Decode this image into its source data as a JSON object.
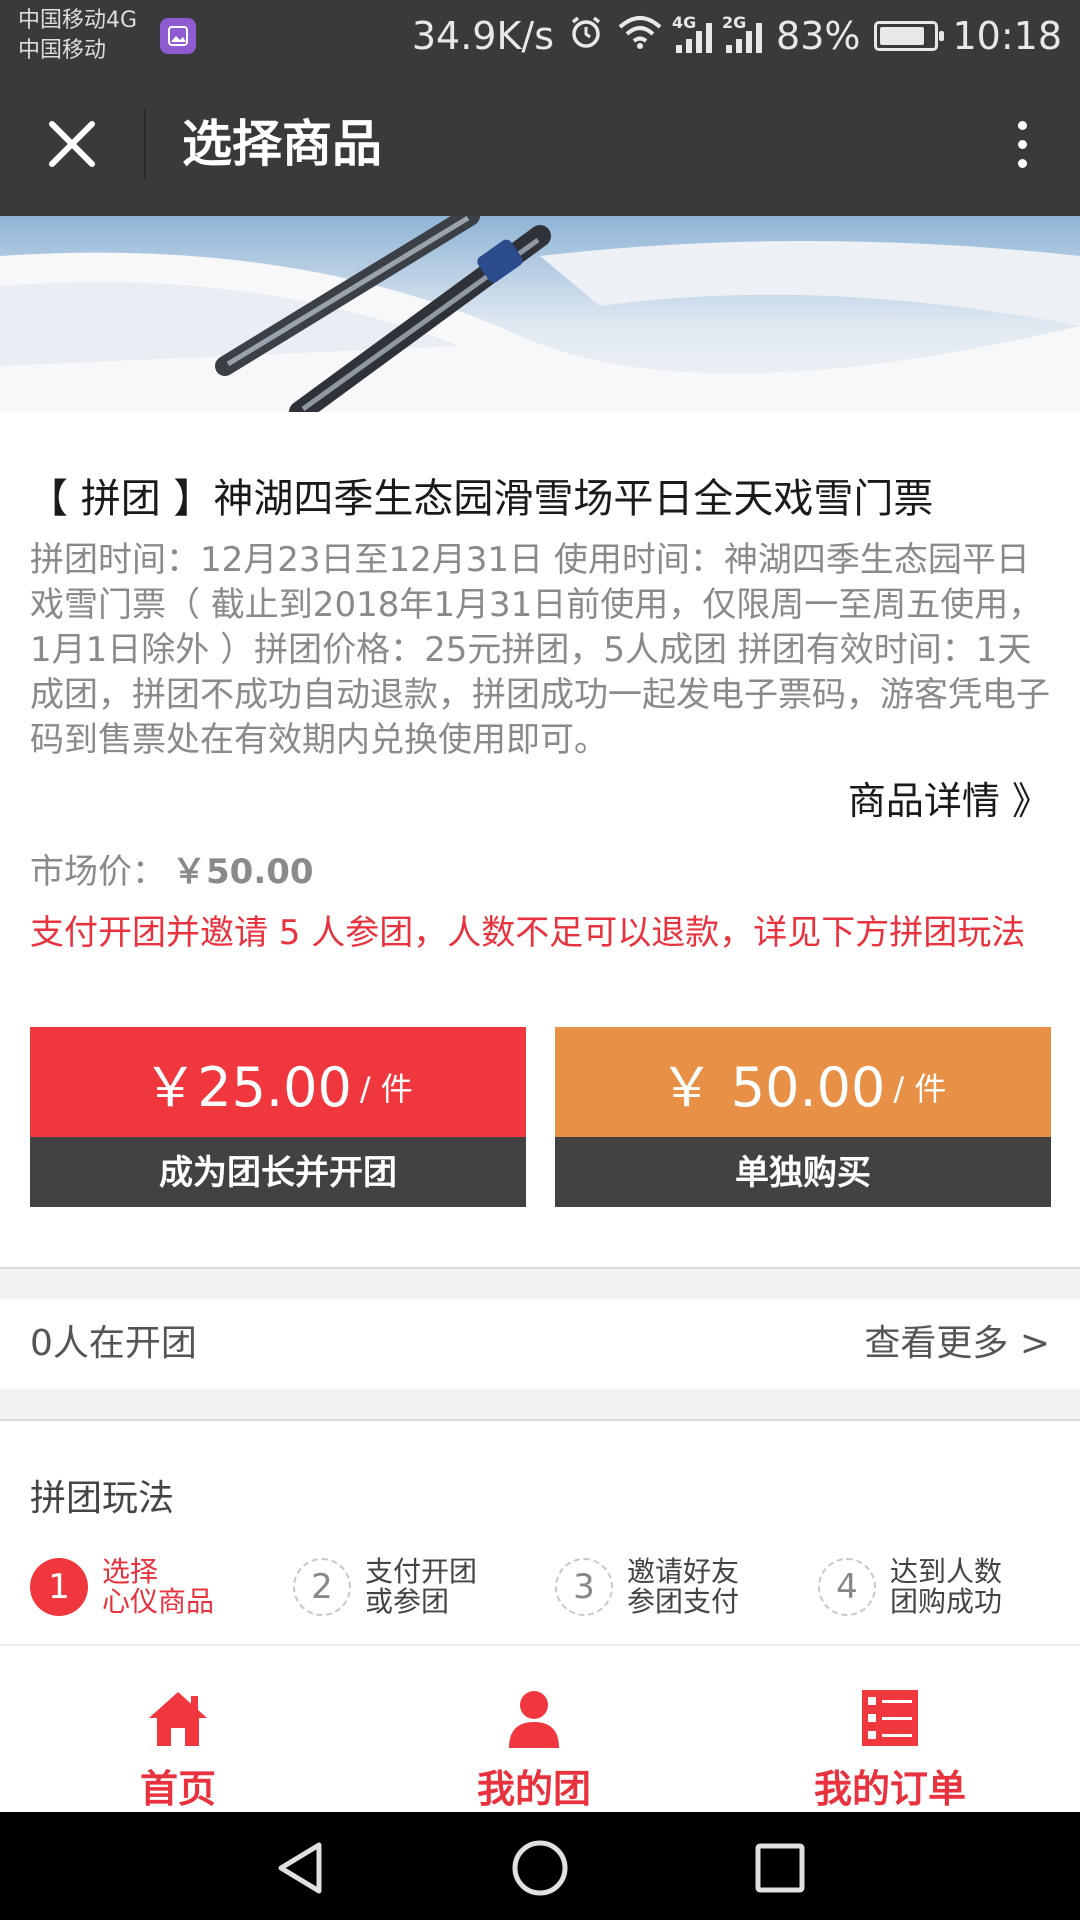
{
  "status_bar": {
    "carrier1": "中国移动4G",
    "carrier2": "中国移动",
    "speed": "34.9K/s",
    "net1": "4G",
    "net2": "2G",
    "battery": "83%",
    "battery_level": 0.83,
    "time": "10:18"
  },
  "header": {
    "title": "选择商品"
  },
  "product": {
    "title": "【 拼团 】神湖四季生态园滑雪场平日全天戏雪门票",
    "description": "拼团时间：12月23日至12月31日 使用时间：神湖四季生态园平日戏雪门票（ 截止到2018年1月31日前使用，仅限周一至周五使用，1月1日除外 ）拼团价格：25元拼团，5人成团 拼团有效时间：1天成团，拼团不成功自动退款，拼团成功一起发电子票码，游客凭电子码到售票处在有效期内兑换使用即可。",
    "detail_link": "商品详情 》",
    "market_label": "市场价：",
    "market_price": "￥50.00",
    "notice": "支付开团并邀请 5 人参团，人数不足可以退款，详见下方拼团玩法"
  },
  "buttons": {
    "group_price": "￥25.00",
    "group_unit": "/ 件",
    "group_label": "成为团长并开团",
    "solo_price": "￥ 50.00",
    "solo_unit": "/ 件",
    "solo_label": "单独购买"
  },
  "groups": {
    "count_text": "0人在开团",
    "more_text": "查看更多 >"
  },
  "rules": {
    "title": "拼团玩法",
    "steps": [
      {
        "num": "1",
        "line1": "选择",
        "line2": "心仪商品"
      },
      {
        "num": "2",
        "line1": "支付开团",
        "line2": "或参团"
      },
      {
        "num": "3",
        "line1": "邀请好友",
        "line2": "参团支付"
      },
      {
        "num": "4",
        "line1": "达到人数",
        "line2": "团购成功"
      }
    ]
  },
  "bottom_nav": {
    "items": [
      {
        "label": "首页",
        "icon": "home-icon"
      },
      {
        "label": "我的团",
        "icon": "user-icon"
      },
      {
        "label": "我的订单",
        "icon": "order-list-icon"
      }
    ]
  },
  "colors": {
    "accent_red": "#f0373e",
    "accent_orange": "#e89045",
    "bar_dark": "#3a3a3c"
  }
}
